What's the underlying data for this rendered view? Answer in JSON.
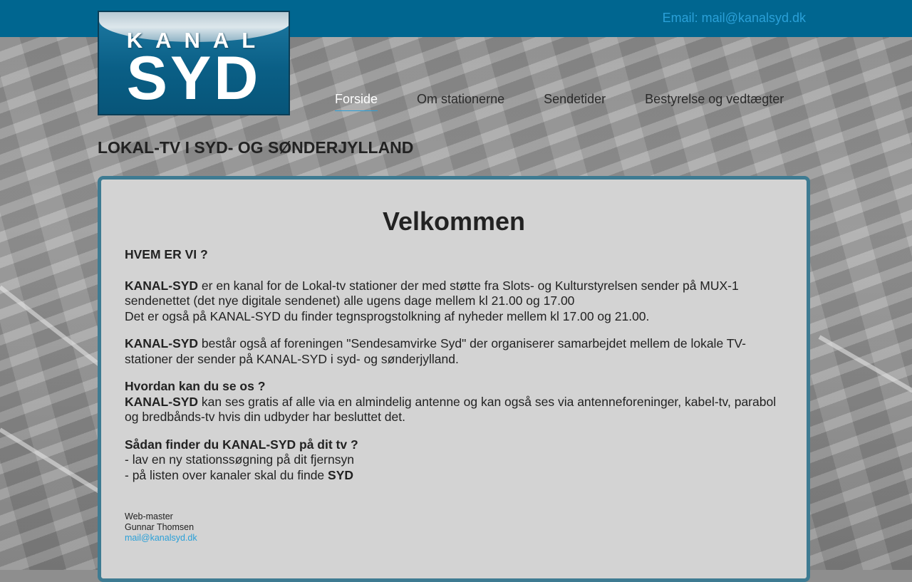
{
  "header": {
    "email_text": "Email: mail@kanalsyd.dk"
  },
  "logo": {
    "top_text": "KANAL",
    "main_text": "SYD"
  },
  "nav": {
    "items": [
      {
        "label": "Forside",
        "active": true
      },
      {
        "label": "Om stationerne",
        "active": false
      },
      {
        "label": "Sendetider",
        "active": false
      },
      {
        "label": "Bestyrelse og vedtægter",
        "active": false
      }
    ]
  },
  "tagline": "LOKAL-TV I SYD- OG SØNDERJYLLAND",
  "content": {
    "heading": "Velkommen",
    "who_heading": "HVEM ER VI ?",
    "p1_strong": "KANAL-SYD",
    "p1_text": " er en kanal for de Lokal-tv stationer der med støtte fra Slots- og Kulturstyrelsen sender på MUX-1 sendenettet (det nye digitale sendenet) alle ugens dage mellem kl 21.00 og 17.00",
    "p1_line2": "Det er også på KANAL-SYD du finder tegnsprogstolkning af nyheder mellem kl 17.00 og 21.00.",
    "p2_strong": "KANAL-SYD",
    "p2_text": " består også af foreningen \"Sendesamvirke Syd\" der organiserer samarbejdet mellem de lokale TV-stationer der sender på KANAL-SYD i syd- og sønderjylland.",
    "p3_heading": "Hvordan kan du se os ?",
    "p3_strong": "KANAL-SYD",
    "p3_text": " kan ses gratis af alle via en almindelig antenne og kan også ses via antenneforeninger, kabel-tv, parabol og bredbånds-tv hvis din udbyder har besluttet det.",
    "p4_heading": "Sådan finder du KANAL-SYD på dit tv ?",
    "p4_line1": "- lav en ny stationssøgning på dit fjernsyn",
    "p4_line2_text": "- på listen over kanaler skal du finde ",
    "p4_line2_strong": "SYD"
  },
  "footer": {
    "role": "Web-master",
    "name": "Gunnar Thomsen",
    "email": "mail@kanalsyd.dk"
  },
  "colors": {
    "topbar": "#006690",
    "link": "#2aa0d8",
    "panel_border": "#3e7b92",
    "panel_bg": "#d3d3d3"
  }
}
